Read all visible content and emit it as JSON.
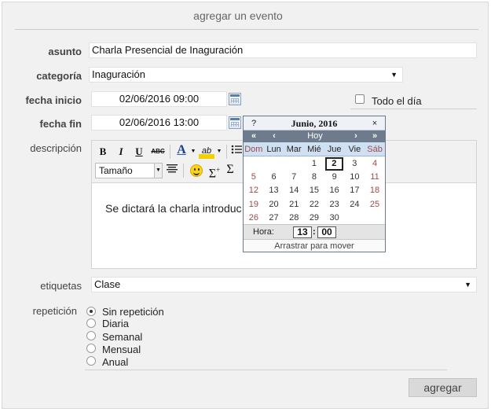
{
  "form": {
    "title": "agregar un evento",
    "subject": {
      "label": "asunto",
      "value": "Charla Presencial de Inaguración"
    },
    "category": {
      "label": "categoría",
      "value": "Inaguración"
    },
    "start": {
      "label": "fecha inicio",
      "value": "02/06/2016 09:00"
    },
    "all_day": {
      "label": "Todo el día",
      "checked": false
    },
    "end": {
      "label": "fecha fin",
      "value": "02/06/2016 13:00"
    },
    "description": {
      "label": "descripción",
      "text": "Se dictará la charla introduc",
      "toolbar": {
        "bold": "B",
        "italic": "I",
        "underline": "U",
        "strike": "ABC",
        "font_color": "A",
        "highlight": "ab",
        "size_select": "Tamaño"
      }
    },
    "tags": {
      "label": "etiquetas",
      "value": "Clase"
    },
    "repeat": {
      "label": "repetición",
      "options": [
        {
          "label": "Sin repetición",
          "selected": true
        },
        {
          "label": "Diaria",
          "selected": false
        },
        {
          "label": "Semanal",
          "selected": false
        },
        {
          "label": "Mensual",
          "selected": false
        },
        {
          "label": "Anual",
          "selected": false
        }
      ]
    },
    "submit_label": "agregar"
  },
  "calendar": {
    "help": "?",
    "month_title": "Junio, 2016",
    "close": "×",
    "nav": {
      "prev_year": "«",
      "prev_month": "‹",
      "today": "Hoy",
      "next_month": "›",
      "next_year": "»"
    },
    "weekdays": [
      "Dom",
      "Lun",
      "Mar",
      "Mié",
      "Jue",
      "Vie",
      "Sáb"
    ],
    "weeks": [
      [
        "",
        "",
        "",
        "1",
        "2",
        "3",
        "4"
      ],
      [
        "5",
        "6",
        "7",
        "8",
        "9",
        "10",
        "11"
      ],
      [
        "12",
        "13",
        "14",
        "15",
        "16",
        "17",
        "18"
      ],
      [
        "19",
        "20",
        "21",
        "22",
        "23",
        "24",
        "25"
      ],
      [
        "26",
        "27",
        "28",
        "29",
        "30",
        "",
        ""
      ]
    ],
    "selected_day": "2",
    "time": {
      "label": "Hora:",
      "hour": "13",
      "separator": ":",
      "minute": "00"
    },
    "footer": "Arrastrar para mover"
  }
}
